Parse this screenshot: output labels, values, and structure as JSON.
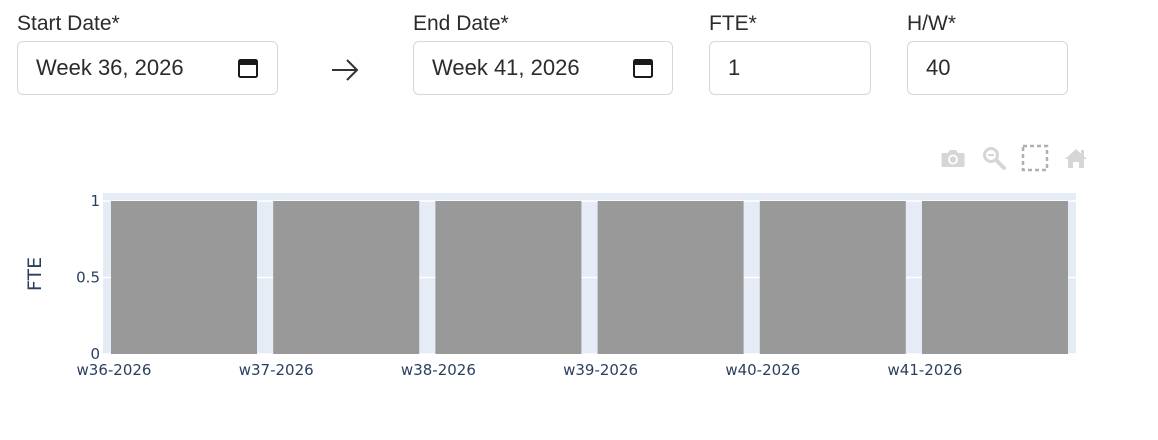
{
  "form": {
    "start_date": {
      "label": "Start Date*",
      "value": "Week 36, 2026"
    },
    "end_date": {
      "label": "End Date*",
      "value": "Week 41, 2026"
    },
    "fte": {
      "label": "FTE*",
      "value": "1"
    },
    "hours_per_week": {
      "label": "H/W*",
      "value": "40"
    }
  },
  "modebar": {
    "icons": [
      "camera-icon",
      "zoom-icon",
      "box-select-icon",
      "home-icon"
    ]
  },
  "colors": {
    "bar": "#999999",
    "plot_bg": "#e5ecf6",
    "grid": "#ffffff",
    "tick_text": "#2a3f5f",
    "modebar_icon": "#d6d6d6"
  },
  "chart_data": {
    "type": "bar",
    "categories": [
      "w36-2026",
      "w37-2026",
      "w38-2026",
      "w39-2026",
      "w40-2026",
      "w41-2026"
    ],
    "values": [
      1,
      1,
      1,
      1,
      1,
      1
    ],
    "xlabel": "",
    "ylabel": "FTE",
    "ylim": [
      0,
      1
    ],
    "yticks": [
      "1",
      "0.5",
      "0"
    ],
    "grid": true,
    "legend": false
  }
}
